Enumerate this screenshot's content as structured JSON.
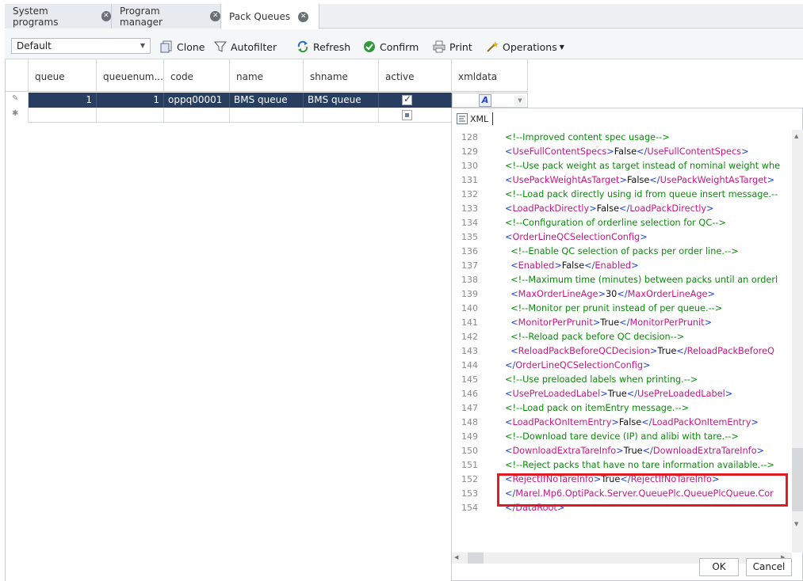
{
  "tabs": [
    {
      "label": "System programs"
    },
    {
      "label": "Program manager"
    },
    {
      "label": "Pack Queues"
    }
  ],
  "toolbar": {
    "layout_value": "Default",
    "clone": "Clone",
    "autofilter": "Autofilter",
    "refresh": "Refresh",
    "confirm": "Confirm",
    "print": "Print",
    "operations": "Operations"
  },
  "columns": [
    "queue",
    "queuenum...",
    "code",
    "name",
    "shname",
    "active",
    "xmldata"
  ],
  "rows": [
    {
      "queue": "1",
      "queuenum": "1",
      "code": "oppq00001",
      "name": "BMS queue",
      "shname": "BMS queue",
      "active": true
    }
  ],
  "xml_editor": {
    "mode_label": "XML",
    "ok": "OK",
    "cancel": "Cancel",
    "lines": [
      {
        "n": "128",
        "text": "<!--Improved content spec usage-->"
      },
      {
        "n": "129",
        "text": "<UseFullContentSpecs>False</UseFullContentSpecs>"
      },
      {
        "n": "130",
        "text": "<!--Use pack weight as target instead of nominal weight whe"
      },
      {
        "n": "131",
        "text": "<UsePackWeightAsTarget>False</UsePackWeightAsTarget>"
      },
      {
        "n": "132",
        "text": "<!--Load pack directly using id from queue insert message.--"
      },
      {
        "n": "133",
        "text": "<LoadPackDirectly>False</LoadPackDirectly>"
      },
      {
        "n": "134",
        "text": "<!--Configuration of orderline selection for QC-->"
      },
      {
        "n": "135",
        "text": "<OrderLineQCSelectionConfig>"
      },
      {
        "n": "136",
        "text": " <!--Enable QC selection of packs per order line.-->"
      },
      {
        "n": "137",
        "text": " <Enabled>False</Enabled>"
      },
      {
        "n": "138",
        "text": " <!--Maximum time (minutes) between packs until an orderl"
      },
      {
        "n": "139",
        "text": " <MaxOrderLineAge>30</MaxOrderLineAge>"
      },
      {
        "n": "140",
        "text": " <!--Monitor per prunit instead of per queue.-->"
      },
      {
        "n": "141",
        "text": " <MonitorPerPrunit>True</MonitorPerPrunit>"
      },
      {
        "n": "142",
        "text": " <!--Reload pack before QC decision-->"
      },
      {
        "n": "143",
        "text": " <ReloadPackBeforeQCDecision>True</ReloadPackBeforeQ"
      },
      {
        "n": "144",
        "text": "</OrderLineQCSelectionConfig>"
      },
      {
        "n": "145",
        "text": "<!--Use preloaded labels when printing.-->"
      },
      {
        "n": "146",
        "text": "<UsePreLoadedLabel>True</UsePreLoadedLabel>"
      },
      {
        "n": "147",
        "text": "<!--Load pack on itemEntry message.-->"
      },
      {
        "n": "148",
        "text": "<LoadPackOnItemEntry>False</LoadPackOnItemEntry>"
      },
      {
        "n": "149",
        "text": "<!--Download tare device (IP) and alibi with tare.-->"
      },
      {
        "n": "150",
        "text": "<DownloadExtraTareInfo>True</DownloadExtraTareInfo>"
      },
      {
        "n": "151",
        "text": "<!--Reject packs that have no tare information available.-->"
      },
      {
        "n": "152",
        "text": "<RejectIfNoTareInfo>True</RejectIfNoTareInfo>"
      },
      {
        "n": "153",
        "text": "</Marel.Mp6.OptiPack.Server.QueuePlc.QueuePlcQueue.Cor"
      },
      {
        "n": "154",
        "text": "</DataRoot>"
      }
    ]
  }
}
